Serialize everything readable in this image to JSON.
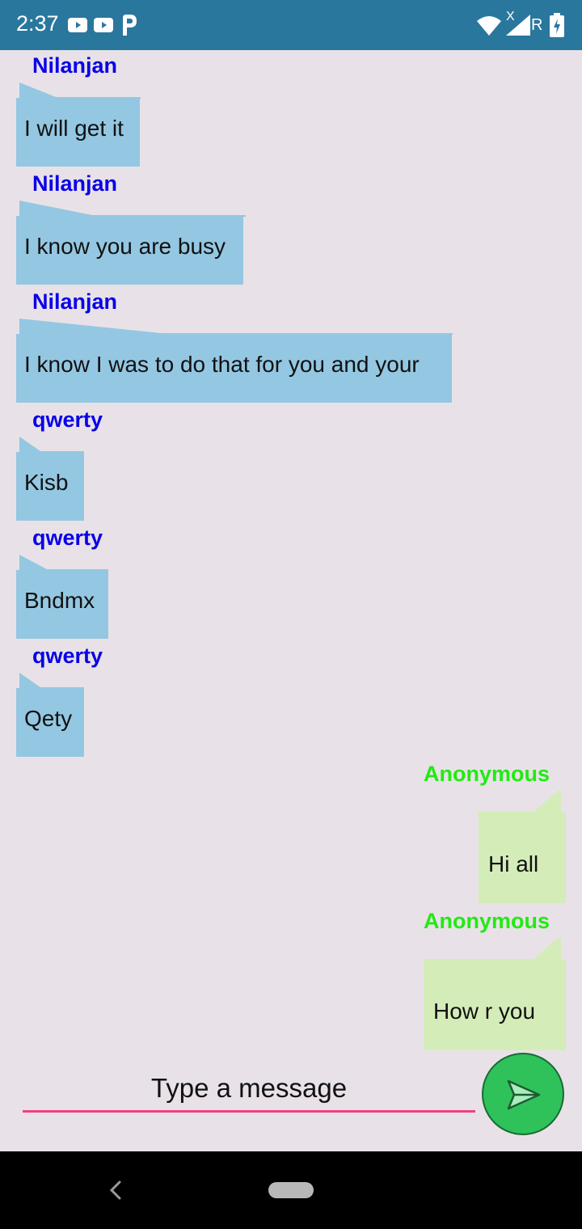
{
  "status_bar": {
    "time": "2:37",
    "icons": [
      "youtube-icon",
      "youtube-icon",
      "parking-icon",
      "wifi-icon",
      "signal-icon",
      "battery-charging-icon"
    ],
    "roaming_label": "R",
    "no_data_label": "X"
  },
  "messages": [
    {
      "sender": "Nilanjan",
      "text": "I will get it",
      "direction": "incoming"
    },
    {
      "sender": "Nilanjan",
      "text": "I know you are busy",
      "direction": "incoming"
    },
    {
      "sender": "Nilanjan",
      "text": "I know I was to do that for you and your",
      "direction": "incoming"
    },
    {
      "sender": "qwerty",
      "text": "Kisb",
      "direction": "incoming"
    },
    {
      "sender": "qwerty",
      "text": "Bndmx",
      "direction": "incoming"
    },
    {
      "sender": "qwerty",
      "text": "Qety",
      "direction": "incoming"
    },
    {
      "sender": "Anonymous",
      "text": "Hi all",
      "direction": "outgoing"
    },
    {
      "sender": "Anonymous",
      "text": "How r you",
      "direction": "outgoing"
    }
  ],
  "composer": {
    "placeholder": "Type a message",
    "value": "",
    "send_icon": "send-icon"
  },
  "colors": {
    "incoming_sender": "#0a00e6",
    "outgoing_sender": "#22ea12",
    "incoming_bubble": "#94c7e2",
    "outgoing_bubble": "#d4ecb8",
    "accent": "#f0417e",
    "send_button": "#2fc25a"
  },
  "nav_bar": {
    "icons": [
      "back-icon",
      "home-pill-icon"
    ]
  }
}
